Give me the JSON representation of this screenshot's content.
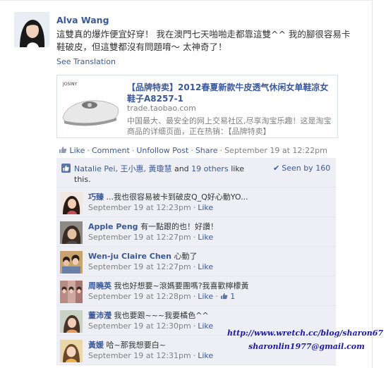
{
  "post": {
    "author": "Alva Wang",
    "message": "這雙真的爆炸便宜好穿！  我在澳門七天啪啪走都靠這雙^^ 我的腳很容易卡鞋破皮，但這雙都沒有問題唷～ 太神奇了！",
    "see_translation": "See Translation"
  },
  "shared_link": {
    "title": "【品牌特卖】2012春夏新款牛皮透气休闲女单鞋凉女鞋子A8257-1",
    "domain": "trade.taobao.com",
    "description": "中国最大、最安全的网上交易社区,尽享淘宝乐趣！这是淘宝商品的详细页面，正在热销：【品牌特卖】",
    "thumb_brand": "JOSINY"
  },
  "actions": {
    "like": "Like",
    "comment": "Comment",
    "unfollow": "Unfollow Post",
    "share": "Share",
    "timestamp": "September 19 at 12:22pm"
  },
  "likes": {
    "names": "Natalie Pei, 王小惠, 黃瓊慧",
    "and": "and",
    "others": "19 others",
    "suffix": "like this.",
    "seen_by": "Seen by 160"
  },
  "comments": [
    {
      "name": "巧臻",
      "text": "...我也很容易被卡到破皮Q_Q好心動YO...",
      "time": "September 19 at 12:23pm",
      "like": "Like",
      "likes_count": ""
    },
    {
      "name": "Apple Peng",
      "text": "有一點跟的也！好讚！",
      "time": "September 19 at 12:27pm",
      "like": "Like",
      "likes_count": ""
    },
    {
      "name": "Wen-ju Claire Chen",
      "text": "心動了",
      "time": "September 19 at 12:27pm",
      "like": "Like",
      "likes_count": ""
    },
    {
      "name": "周曉英",
      "text": "我也好想要~滾媽要團嗎?我喜歡檸檬黃",
      "time": "September 19 at 12:28pm",
      "like": "Like",
      "likes_count": "1"
    },
    {
      "name": "董沛瀅",
      "text": "我也要跟~~~我要橘色^^",
      "time": "September 19 at 12:30pm",
      "like": "Like",
      "likes_count": ""
    },
    {
      "name": "黃媛",
      "text": "哈~那我想要白~",
      "time": "September 19 at 12:31pm",
      "like": "Like",
      "likes_count": ""
    }
  ],
  "watermark": {
    "url": "http://www.wretch.cc/blog/sharon67",
    "email": "sharonlin1977@gmail.com"
  },
  "colors": {
    "link": "#3b5998",
    "ufi_bg": "#edeff4",
    "meta": "#808080",
    "watermark": "#1a1aa8"
  }
}
